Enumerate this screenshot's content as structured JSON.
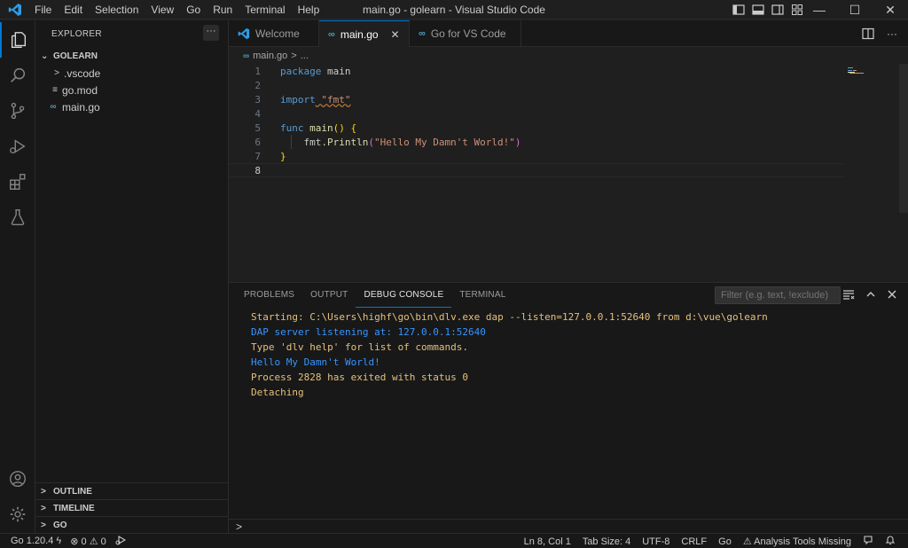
{
  "window": {
    "title": "main.go - golearn - Visual Studio Code",
    "menu": [
      "File",
      "Edit",
      "Selection",
      "View",
      "Go",
      "Run",
      "Terminal",
      "Help"
    ],
    "controls": {
      "minimize": "—",
      "maximize": "☐",
      "close": "✕"
    }
  },
  "sidebar": {
    "header": "EXPLORER",
    "more": "···",
    "folder": "GOLEARN",
    "items": [
      {
        "label": ".vscode",
        "icon": ">"
      },
      {
        "label": "go.mod",
        "icon": "≡"
      },
      {
        "label": "main.go",
        "icon": "∞"
      }
    ],
    "bottom_sections": [
      "OUTLINE",
      "TIMELINE",
      "GO"
    ]
  },
  "tabs": [
    {
      "label": "Welcome",
      "icon": "vscode-icon"
    },
    {
      "label": "main.go",
      "icon": "go-icon",
      "close": "✕"
    },
    {
      "label": "Go for VS Code",
      "icon": "go-icon"
    }
  ],
  "breadcrumb": {
    "file": "main.go",
    "sep": ">",
    "rest": "..."
  },
  "editor": {
    "line_numbers": [
      "1",
      "2",
      "3",
      "4",
      "5",
      "6",
      "7",
      "8"
    ],
    "current_line": 8,
    "code": {
      "l1_kw": "package",
      "l1_name": " main",
      "l3_kw": "import",
      "l3_str": " \"fmt\"",
      "l5_kw": "func",
      "l5_fn": " main",
      "l5_paren": "()",
      "l5_brace": " {",
      "l6_pkg": "    fmt",
      "l6_dot": ".",
      "l6_fn": "Println",
      "l6_open": "(",
      "l6_str": "\"Hello My Damn't World!\"",
      "l6_close": ")",
      "l7_brace": "}"
    }
  },
  "panel": {
    "tabs": [
      "PROBLEMS",
      "OUTPUT",
      "DEBUG CONSOLE",
      "TERMINAL"
    ],
    "active_tab": "DEBUG CONSOLE",
    "filter_placeholder": "Filter (e.g. text, !exclude)",
    "console": [
      {
        "text": "Starting: C:\\Users\\highf\\go\\bin\\dlv.exe dap --listen=127.0.0.1:52640 from d:\\vue\\golearn",
        "kind": "warn"
      },
      {
        "text": "DAP server listening at: 127.0.0.1:52640",
        "kind": "info"
      },
      {
        "text": "Type 'dlv help' for list of commands.",
        "kind": "warn"
      },
      {
        "text": "Hello My Damn't World!",
        "kind": "info"
      },
      {
        "text": "Process 2828 has exited with status 0",
        "kind": "warn"
      },
      {
        "text": "Detaching",
        "kind": "warn"
      }
    ],
    "prompt": ">"
  },
  "statusbar": {
    "go_version": "Go 1.20.4",
    "errors": "0",
    "warnings": "0",
    "position": "Ln 8, Col 1",
    "tab_size": "Tab Size: 4",
    "encoding": "UTF-8",
    "eol": "CRLF",
    "language": "Go",
    "analysis": "Analysis Tools Missing"
  },
  "colors": {
    "accent": "#0078d4",
    "background": "#1f1f1f",
    "sidebar": "#181818",
    "keyword": "#569cd6",
    "string": "#ce9178",
    "function": "#dcdcaa",
    "console_warn": "#e5c07b",
    "console_info": "#3794ff"
  }
}
